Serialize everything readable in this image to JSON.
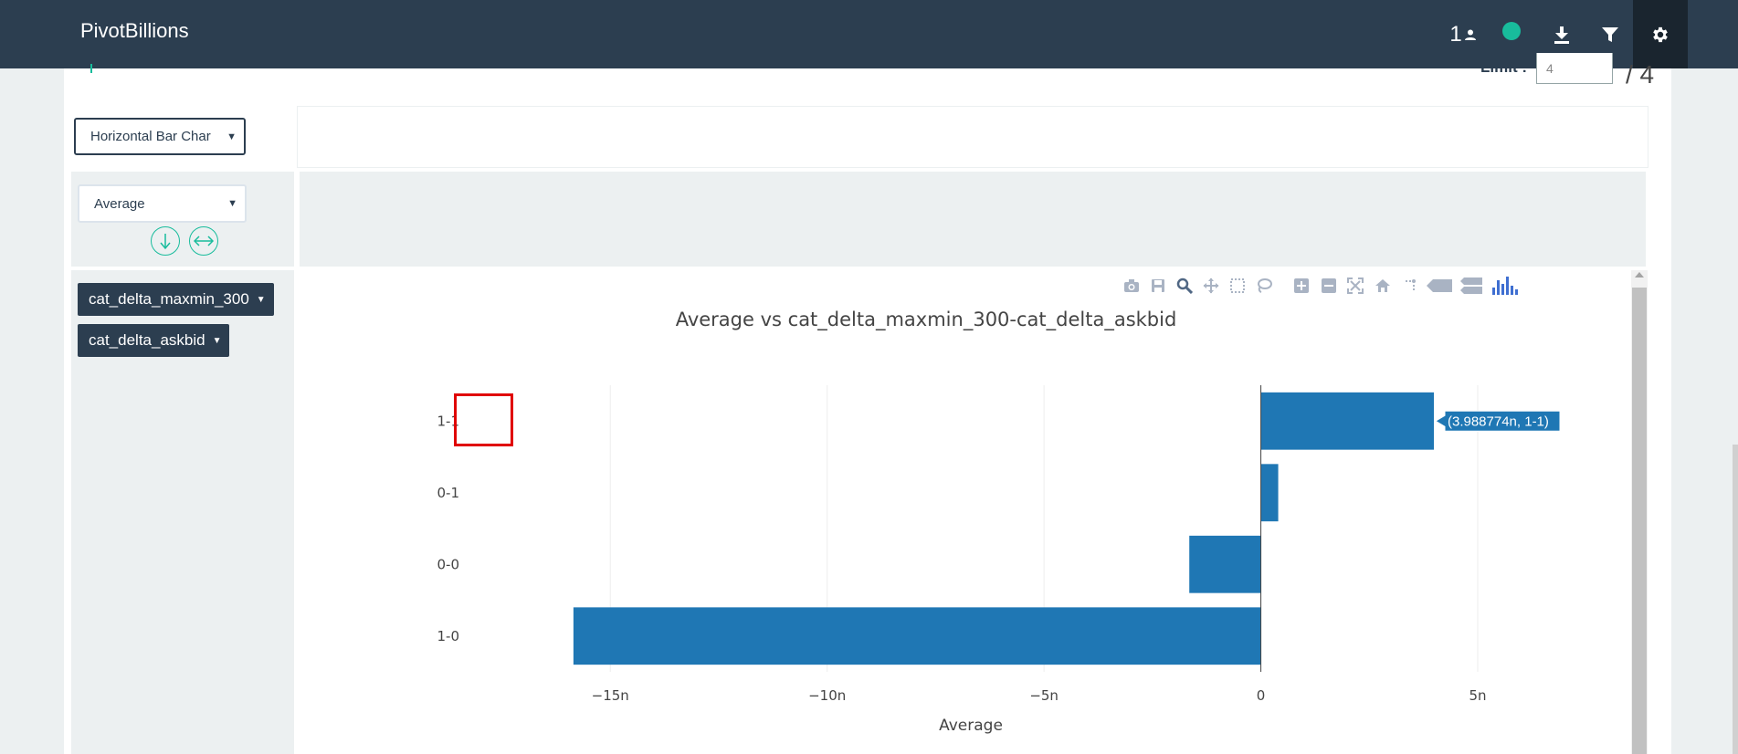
{
  "app": {
    "title": "PivotBillions"
  },
  "navbar": {
    "user_count": "1"
  },
  "limit": {
    "label": "Limit :",
    "value": "4",
    "total": "/ 4"
  },
  "controls": {
    "chart_type": "Horizontal Bar Char",
    "aggregation": "Average"
  },
  "dimensions": [
    {
      "label": "cat_delta_maxmin_300"
    },
    {
      "label": "cat_delta_askbid"
    }
  ],
  "colors": {
    "navbar": "#2c3e50",
    "accent": "#18bc9c",
    "bar": "#1f77b4",
    "highlight": "#e00000"
  },
  "icons": {
    "navbar": [
      "user-icon",
      "status-dot-icon",
      "download-icon",
      "filter-icon",
      "gear-icon"
    ],
    "modebar": [
      "camera-icon",
      "save-icon",
      "zoom-icon",
      "pan-icon",
      "box-select-icon",
      "lasso-icon",
      "zoom-in-icon",
      "zoom-out-icon",
      "autoscale-icon",
      "reset-axes-icon",
      "spike-lines-icon",
      "hover-closest-icon",
      "hover-compare-icon",
      "plotly-logo-icon"
    ]
  },
  "chart_data": {
    "type": "bar",
    "orientation": "horizontal",
    "title": "Average vs cat_delta_maxmin_300-cat_delta_askbid",
    "xlabel": "Average",
    "ylabel": "",
    "categories": [
      "1-1",
      "0-1",
      "0-0",
      "1-0"
    ],
    "values": [
      3.988774e-09,
      4e-10,
      -1.65e-09,
      -1.585e-08
    ],
    "xlim": [
      -1.65e-08,
      7e-09
    ],
    "xticks": [
      {
        "value": -1.5e-08,
        "label": "−15n"
      },
      {
        "value": -1e-08,
        "label": "−10n"
      },
      {
        "value": -5e-09,
        "label": "−5n"
      },
      {
        "value": 0,
        "label": "0"
      },
      {
        "value": 5e-09,
        "label": "5n"
      }
    ],
    "grid": true,
    "hover_label": "(3.988774n, 1-1)",
    "highlighted_category": "1-1"
  }
}
